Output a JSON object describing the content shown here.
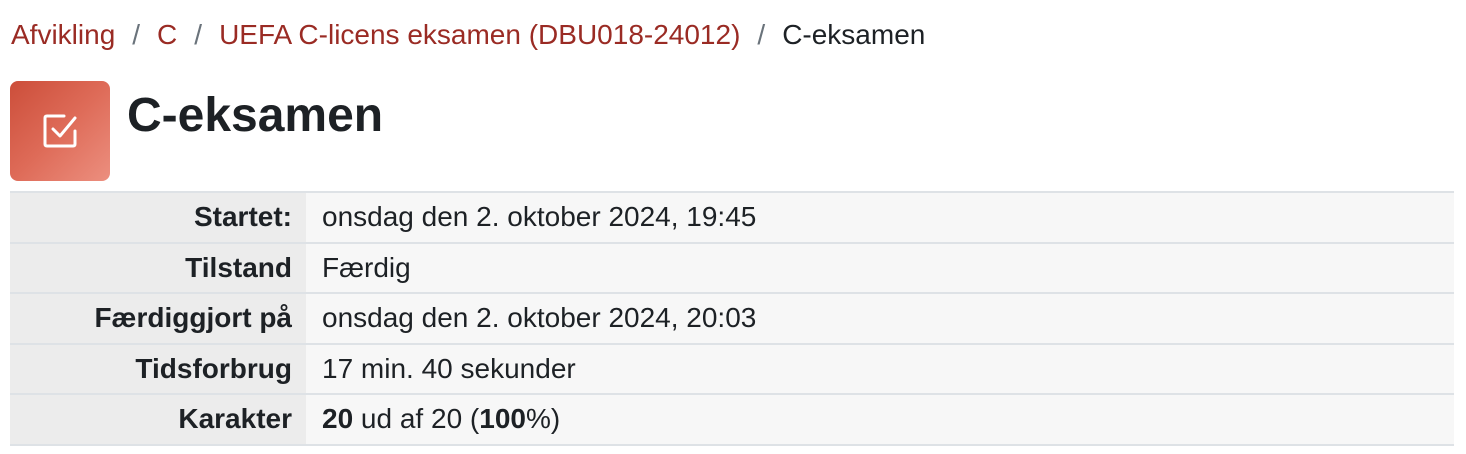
{
  "breadcrumb": {
    "items": [
      "Afvikling",
      "C",
      "UEFA C-licens eksamen (DBU018-24012)"
    ],
    "separator": "/",
    "current": "C-eksamen"
  },
  "header": {
    "icon": "quiz-checkbox-icon",
    "title": "C-eksamen"
  },
  "summary": {
    "rows": [
      {
        "label": "Startet:",
        "value": "onsdag den 2. oktober 2024, 19:45"
      },
      {
        "label": "Tilstand",
        "value": "Færdig"
      },
      {
        "label": "Færdiggjort på",
        "value": "onsdag den 2. oktober 2024, 20:03"
      },
      {
        "label": "Tidsforbrug",
        "value": "17 min. 40 sekunder"
      }
    ],
    "grade": {
      "label": "Karakter",
      "score": "20",
      "middle": " ud af 20 (",
      "percent": "100",
      "suffix": "%)"
    }
  },
  "colors": {
    "link": "#9a2b24",
    "icon_gradient_start": "#cc4e3a",
    "icon_gradient_end": "#ec8f7f"
  }
}
